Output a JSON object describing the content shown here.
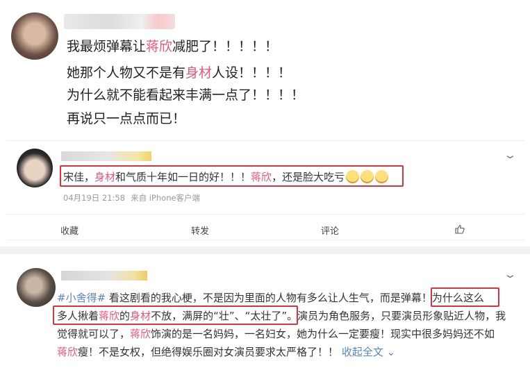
{
  "post1": {
    "lines": [
      {
        "a": "我最烦弹幕让",
        "b": "蒋欣",
        "c": "减肥了！！！！！"
      },
      {
        "a": "她那个人物又不是有",
        "b": "身材",
        "c": "人设！！！！"
      },
      {
        "a": "为什么就不能看起来丰满一点了！！！！"
      },
      {
        "a": "再说只一点点而已！"
      }
    ]
  },
  "post2": {
    "seg1": "宋佳，",
    "seg2": "身材",
    "seg3": "和气质十年如一日的好！！！",
    "seg4": "蒋欣",
    "seg5": "，还是脸大吃亏",
    "emoji_icon": "laugh-cry-emoji",
    "date": "04月19日 21:58",
    "source": "来自 iPhone客户端"
  },
  "actions": {
    "collect": "收藏",
    "repost": "转发",
    "comment": "评论",
    "like_icon": "thumbs-up-icon"
  },
  "post3": {
    "l1": {
      "tag": "#小舍得#",
      "t1": " 看这剧看的我心梗，不是因为里面的人物有多么让人生气，而是弹幕",
      "t2": "！为什么这么"
    },
    "l2": {
      "t1": "多人揪着",
      "p1": "蒋欣",
      "t2": "的",
      "p2": "身材",
      "t3": "不放，满屏的“壮”、“太壮了”",
      "t4": "。演员为角色服务，只要演员形象贴近人物，我"
    },
    "l3": {
      "t1": "觉得就可以了，",
      "p1": "蒋欣",
      "t2": "饰演的是一名妈妈，一名妇女，她为什么一定要瘦！现实中很多妈妈还不如"
    },
    "l4": {
      "p1": "蒋欣",
      "t1": "瘦！不是女权，但绝得娱乐圈对女演员要求太严格了！！",
      "more": "收起全文"
    }
  }
}
